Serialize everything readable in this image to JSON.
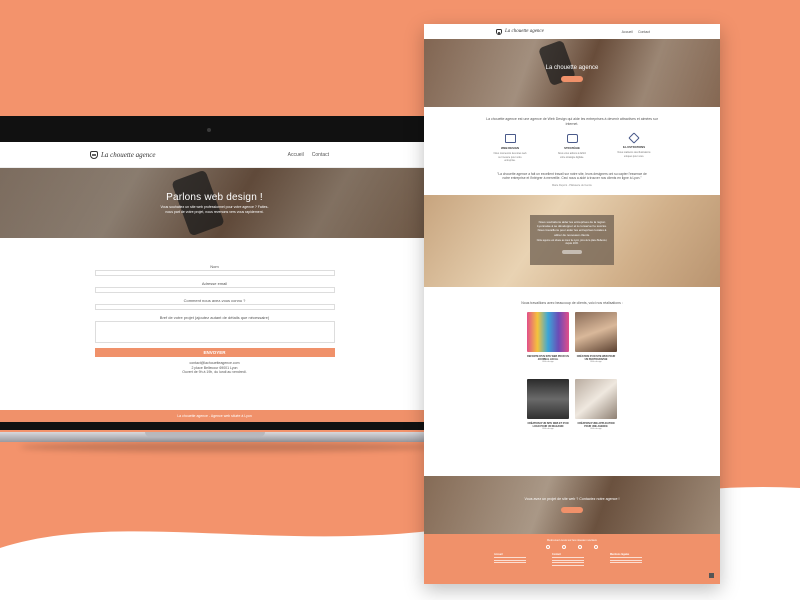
{
  "laptop": {
    "nav": {
      "logo": "La chouette agence",
      "links": [
        "Accueil",
        "Contact"
      ]
    },
    "hero": {
      "title": "Parlons web design !",
      "subtitle": "Vous souhaitez un site web professionnel pour votre agence ? Faites-nous part de votre projet, nous revenons vers vous rapidement."
    },
    "form": {
      "fields": [
        "Nom",
        "Adresse email",
        "Comment nous avez-vous connu ?",
        "Bref de votre projet (ajoutez autant de détails que nécessaire)"
      ],
      "submit": "ENVOYER"
    },
    "contact": [
      "contact@lachouetteagence.com",
      "2 place Bellecour 69001 Lyon",
      "Ouvert de 9h à 19h, du lundi au vendredi."
    ],
    "footer": "La chouette agence - Agence web située à Lyon"
  },
  "page": {
    "nav": {
      "logo": "La chouette agence",
      "links": [
        "Accueil",
        "Contact"
      ]
    },
    "hero_title": "La chouette agence",
    "intro": "La chouette agence est une agence de Web Design qui aide les entreprises à devenir attractives et aimées sur internet.",
    "features": [
      {
        "icon": "web-design-icon",
        "title": "WEB DESIGN",
        "text": "Nous concevons des sites web sur mesure pour votre entreprise."
      },
      {
        "icon": "strategy-icon",
        "title": "STRATÉGIE",
        "text": "Nous vous aidons à définir votre stratégie digitale."
      },
      {
        "icon": "illustration-icon",
        "title": "ILLUSTRATIONS",
        "text": "Nous réalisons des illustrations uniques pour vous."
      }
    ],
    "quote": {
      "text": "\"La chouette agence a fait un excellent travail sur notre site, leurs designers ont su capter l'essence de notre entreprise et l'intégrer à merveille. Ceci nous a aidé à trouver nos clients en ligne à Lyon.\"",
      "author": "Marie Dupont - Pâtisserie du Centre"
    },
    "mid": {
      "text": "Nous souhaitons aider les entreprises de la région Lyonnaise à se développer et à conserver le succès. Nous travaillons pour aider les entreprises locales à attirer de nouveaux clients.",
      "sub": "Notre agence est située au cœur de Lyon, près de la place Bellecour, depuis 2015."
    },
    "projects_title": "Nous travaillons avec beaucoup de clients, voici nos réalisations :",
    "projects": [
      {
        "title": "REFONTE D'UN SITE WEB POUR UN JOURNAL LOCAL",
        "tag": "Web design",
        "thumb": "t1"
      },
      {
        "title": "CRÉATION D'UN SITE WEB POUR UN PHOTOGRAPHE",
        "tag": "Web design",
        "thumb": "t2"
      },
      {
        "title": "CRÉATION D'UN SITE WEB ET D'UN LOGO POUR UN MAGASIN",
        "tag": "Web design",
        "thumb": "t3"
      },
      {
        "title": "CRÉATION D'UNE APPLICATION POUR UNE AGENCE",
        "tag": "Web design",
        "thumb": "t4"
      }
    ],
    "cta": "Vous avez un projet de site web ? Contactez notre agence !",
    "footer": {
      "heading": "Retrouvez-nous sur les réseaux sociaux",
      "social": [
        "twitter-icon",
        "facebook-icon",
        "instagram-icon",
        "linkedin-icon"
      ],
      "cols": [
        "Accueil",
        "Contact",
        "Mentions légales"
      ]
    }
  },
  "colors": {
    "accent": "#f0916a",
    "wave": "#f3936c"
  }
}
